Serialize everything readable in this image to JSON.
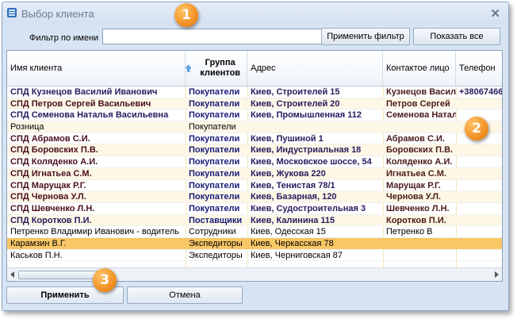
{
  "window": {
    "title": "Выбор клиента",
    "close_glyph": "✕"
  },
  "filter": {
    "label": "Фильтр по имени",
    "value": "",
    "placeholder": "",
    "apply_label": "Применить фильтр",
    "show_all_label": "Показать все"
  },
  "grid": {
    "columns": [
      {
        "key": "name",
        "label": "Имя клиента"
      },
      {
        "key": "group",
        "label": "Группа клиентов",
        "sorted": "ascending"
      },
      {
        "key": "address",
        "label": "Адрес"
      },
      {
        "key": "contact",
        "label": "Контактое лицо"
      },
      {
        "key": "phone",
        "label": "Телефон"
      }
    ],
    "rows": [
      {
        "name": "СПД Кузнецов Василий Иванович",
        "group": "Покупатели",
        "address": "Киев, Строителей 15",
        "contact": "Кузнецов Васил",
        "phone": "+38067466",
        "bold": true
      },
      {
        "name": "СПД Петров Сергей Васильевич",
        "group": "Покупатели",
        "address": "Киев, Строителей 20",
        "contact": "Петров Сергей",
        "phone": "",
        "bold": true
      },
      {
        "name": "СПД Семенова Наталья Васильевна",
        "group": "Покупатели",
        "address": "Киев, Промышленная 112",
        "contact": "Семенова Натал",
        "phone": "",
        "bold": true
      },
      {
        "name": "Розница",
        "group": "Покупатели",
        "address": "",
        "contact": "",
        "phone": "",
        "bold": false
      },
      {
        "name": "СПД Абрамов С.И.",
        "group": "Покупатели",
        "address": "Киев, Пушиной 1",
        "contact": "Абрамов С.И.",
        "phone": "",
        "bold": true
      },
      {
        "name": "СПД Боровских П.В.",
        "group": "Покупатели",
        "address": "Киев, Индустриальная 18",
        "contact": "Боровских П.В.",
        "phone": "",
        "bold": true
      },
      {
        "name": "СПД Коляденко А.И.",
        "group": "Покупатели",
        "address": "Киев, Московское шоссе, 54",
        "contact": "Коляденко А.И.",
        "phone": "",
        "bold": true
      },
      {
        "name": "СПД Игнатьеа С.М.",
        "group": "Покупатели",
        "address": "Киев, Жукова 220",
        "contact": "Игнатьеа С.М.",
        "phone": "",
        "bold": true
      },
      {
        "name": "СПД Марущак Р.Г.",
        "group": "Покупатели",
        "address": "Киев, Тенистая 78/1",
        "contact": "Марущак Р.Г.",
        "phone": "",
        "bold": true
      },
      {
        "name": "СПД Чернова У.Л.",
        "group": "Покупатели",
        "address": "Киев, Базарная, 120",
        "contact": "Чернова У.Л.",
        "phone": "",
        "bold": true
      },
      {
        "name": "СПД Шевченко Л.Н.",
        "group": "Покупатели",
        "address": "Киев, Судостроительная 3",
        "contact": "Шевченко Л.Н.",
        "phone": "",
        "bold": true
      },
      {
        "name": "СПД Коротков П.И.",
        "group": "Поставщики",
        "address": "Киев, Калинина 115",
        "contact": "Коротков П.И.",
        "phone": "",
        "bold": true
      },
      {
        "name": "Петренко Владимир Иванович - водитель",
        "group": "Сотрудники",
        "address": "Киев, Одесская 15",
        "contact": "Петренко В",
        "phone": "",
        "bold": false
      },
      {
        "name": "Карамзин В.Г.",
        "group": "Экспедиторы",
        "address": "Киев, Черкасская 78",
        "contact": "",
        "phone": "",
        "bold": false,
        "selected": true
      },
      {
        "name": "Каськов П.Н.",
        "group": "Экспедиторы",
        "address": "Киев, Черниговская 87",
        "contact": "",
        "phone": "",
        "bold": false
      }
    ]
  },
  "footer": {
    "apply_label": "Применить",
    "cancel_label": "Отмена"
  },
  "callouts": [
    "1",
    "2",
    "3"
  ],
  "colors": {
    "accent": "#f08a1c",
    "selected_row": "#f8c766",
    "alt_row": "#fdf7e6"
  }
}
